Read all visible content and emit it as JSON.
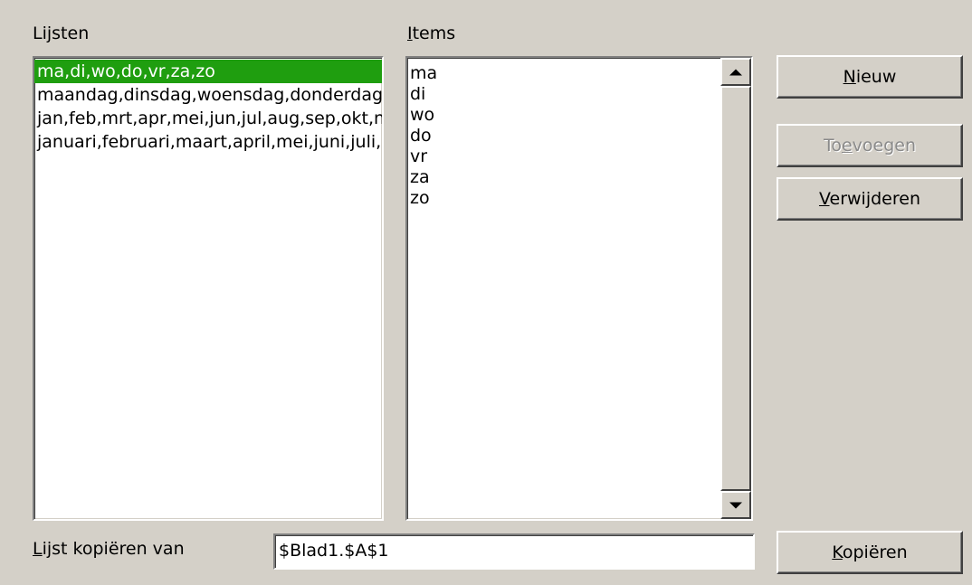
{
  "lists_label": "Lijsten",
  "items_label": "Items",
  "lists": [
    "ma,di,wo,do,vr,za,zo",
    "maandag,dinsdag,woensdag,donderdag,vrijdag,zaterdag,zondag",
    "jan,feb,mrt,apr,mei,jun,jul,aug,sep,okt,nov,dec",
    "januari,februari,maart,april,mei,juni,juli,augustus,september,oktober,november,december"
  ],
  "selected_list_index": 0,
  "items": [
    "ma",
    "di",
    "wo",
    "do",
    "vr",
    "za",
    "zo"
  ],
  "buttons": {
    "new": "Nieuw",
    "add": "Toevoegen",
    "delete": "Verwijderen",
    "copy": "Kopiëren"
  },
  "copy_from_label": "Lijst kopiëren van",
  "copy_from_value": "$Blad1.$A$1",
  "colors": {
    "selection": "#1f9e0f",
    "dialog_bg": "#d4d0c8"
  }
}
